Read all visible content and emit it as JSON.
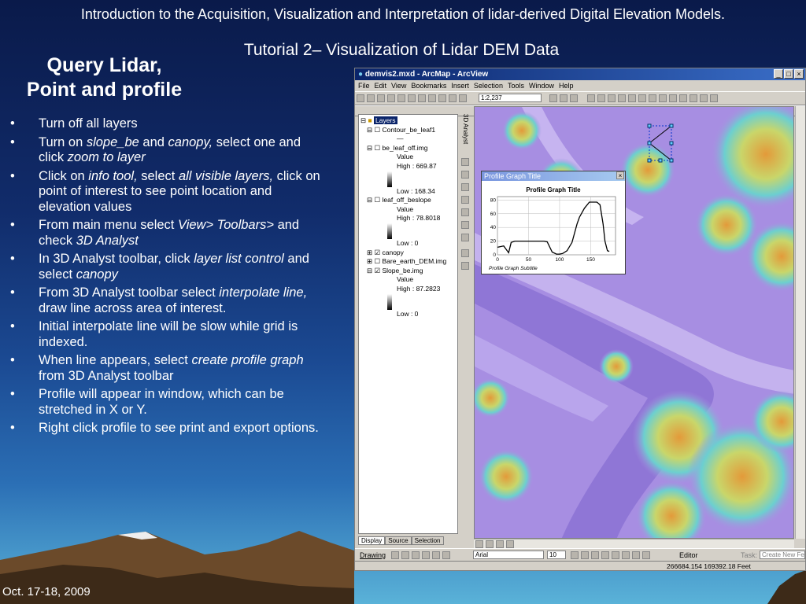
{
  "slide": {
    "header": "Introduction to the Acquisition, Visualization and Interpretation of lidar-derived Digital Elevation Models.",
    "subtitle": "Tutorial 2– Visualization of Lidar DEM Data",
    "title_line1": "Query Lidar,",
    "title_line2": "Point and profile",
    "footer": "Oct. 17-18, 2009",
    "bullets": [
      [
        "Turn off all layers"
      ],
      [
        "Turn on ",
        "slope_be",
        " and ",
        "canopy,",
        " select one and click ",
        "zoom to layer"
      ],
      [
        "Click on ",
        "info tool,",
        " select ",
        "all visible layers,",
        " click on point of interest to see point location and elevation values"
      ],
      [
        "From main menu select ",
        "View> Toolbars>",
        " and check ",
        "3D Analyst"
      ],
      [
        "In 3D Analyst toolbar, click ",
        "layer list control",
        " and select ",
        "canopy"
      ],
      [
        "From 3D Analyst toolbar select ",
        "interpolate line,",
        " draw line across area of interest."
      ],
      [
        "Initial interpolate line will be slow while grid is indexed."
      ],
      [
        "When line appears, select ",
        "create profile graph",
        " from 3D Analyst toolbar"
      ],
      [
        "Profile will appear in window, which can be stretched in X or Y."
      ],
      [
        "Right click profile to see print and export options."
      ]
    ]
  },
  "app": {
    "title": "demvis2.mxd - ArcMap - ArcView",
    "menu": [
      "File",
      "Edit",
      "View",
      "Bookmarks",
      "Insert",
      "Selection",
      "Tools",
      "Window",
      "Help"
    ],
    "scale": "1:2,237",
    "vertical_toolbar_label": "3D Analyst",
    "toc": {
      "root": "Layers",
      "layers": [
        {
          "name": "Contour_be_leaf1",
          "checked": false,
          "legend": [
            "—"
          ]
        },
        {
          "name": "be_leaf_off.img",
          "checked": false,
          "legend": [
            "Value",
            "High : 669.87",
            "Low : 168.34"
          ]
        },
        {
          "name": "leaf_off_beslope",
          "checked": false,
          "legend": [
            "Value",
            "High : 78.8018",
            "Low : 0"
          ]
        },
        {
          "name": "canopy",
          "checked": true,
          "legend": []
        },
        {
          "name": "Bare_earth_DEM.img",
          "checked": false,
          "legend": []
        },
        {
          "name": "Slope_be.img",
          "checked": true,
          "legend": [
            "Value",
            "High : 87.2823",
            "Low : 0"
          ]
        }
      ],
      "tabs": [
        "Display",
        "Source",
        "Selection"
      ]
    },
    "drawing_label": "Drawing",
    "font_name": "Arial",
    "font_size": "10",
    "editor_label": "Editor",
    "task_label": "Task:",
    "task_value": "Create New Feature",
    "coordinates": "266684.154  169392.18 Feet"
  },
  "chart_data": {
    "type": "line",
    "window_title": "Profile Graph Title",
    "title": "Profile Graph Title",
    "subtitle": "Profile Graph Subtitle",
    "xlim": [
      0,
      190
    ],
    "ylim": [
      0,
      85
    ],
    "xticks": [
      0,
      50,
      100,
      150
    ],
    "yticks": [
      0,
      20,
      40,
      60,
      80
    ],
    "x": [
      0,
      10,
      18,
      22,
      28,
      75,
      80,
      88,
      95,
      100,
      105,
      112,
      120,
      128,
      132,
      140,
      148,
      160,
      165,
      170,
      173,
      177,
      180
    ],
    "y": [
      11,
      13,
      3,
      18,
      20,
      20,
      19,
      4,
      1,
      1,
      2,
      6,
      18,
      45,
      55,
      68,
      77,
      77,
      73,
      45,
      20,
      6,
      5
    ]
  }
}
